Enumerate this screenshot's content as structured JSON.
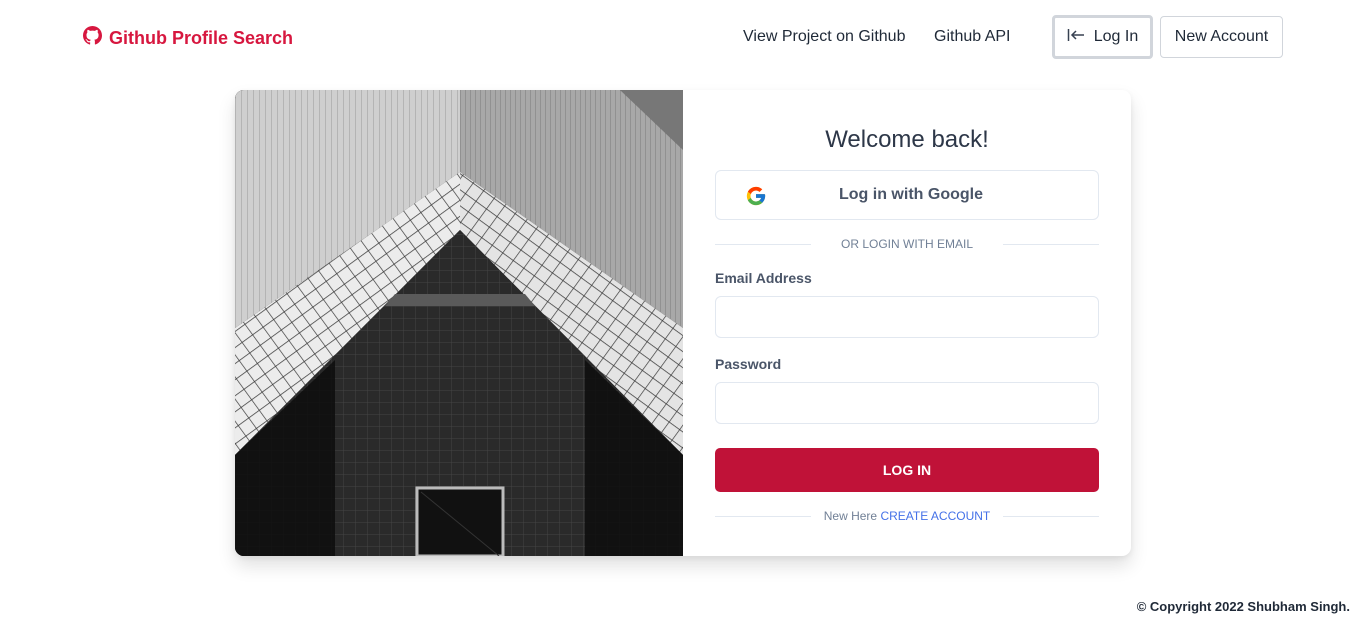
{
  "nav": {
    "brand": "Github Profile Search",
    "links": [
      "View Project on Github",
      "Github API"
    ],
    "login_label": "Log In",
    "new_account_label": "New Account"
  },
  "form": {
    "title": "Welcome back!",
    "google_label": "Log in with Google",
    "divider_text": "or login with email",
    "email_label": "Email Address",
    "email_value": "",
    "password_label": "Password",
    "password_value": "",
    "submit_label": "LOG IN",
    "new_here": "New Here",
    "create_account": "create account"
  },
  "footer": {
    "copyright": "© Copyright 2022 Shubham Singh."
  },
  "colors": {
    "brand": "#d7173f",
    "submit": "#c01238",
    "link": "#4471e8"
  },
  "icons": [
    "github-icon",
    "login-arrow-icon",
    "google-icon"
  ]
}
